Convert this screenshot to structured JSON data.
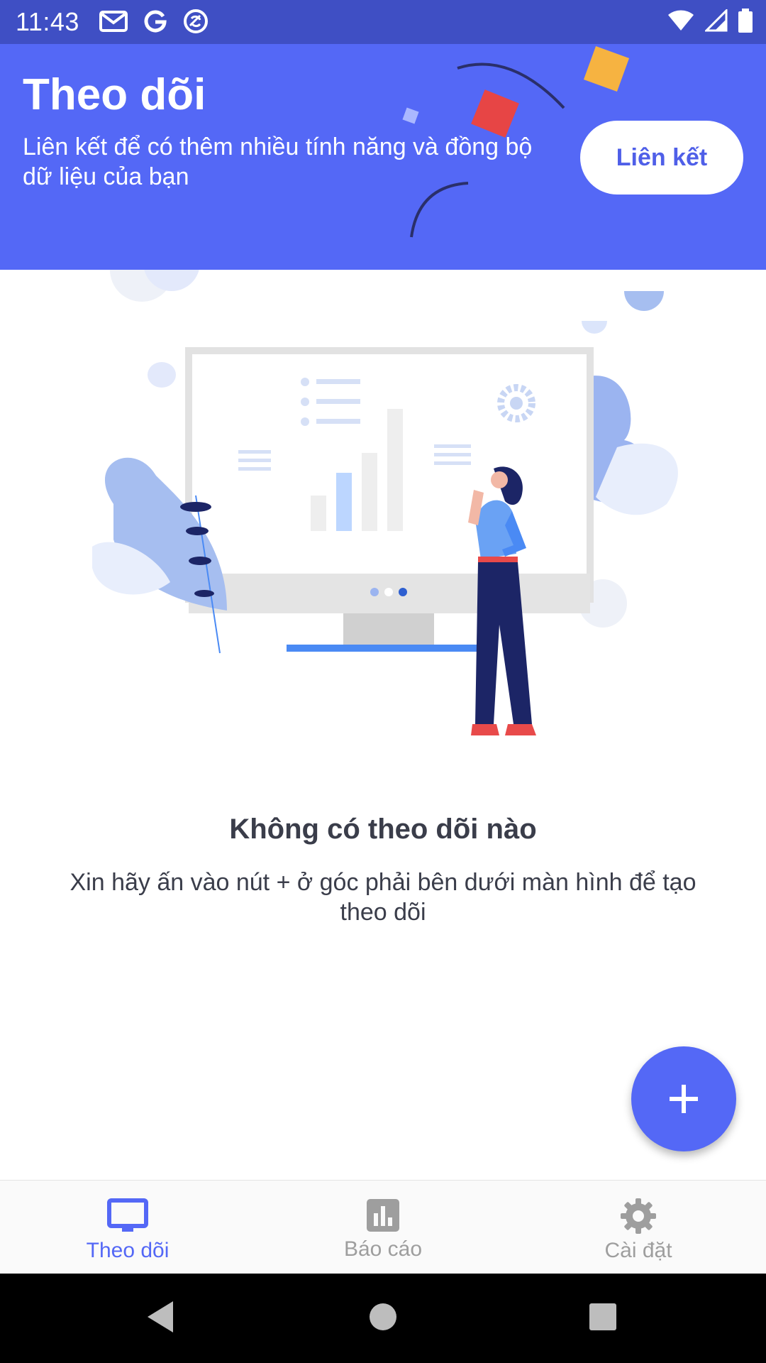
{
  "status_bar": {
    "time": "11:43",
    "icons_left": [
      "gmail-icon",
      "google-icon",
      "sync-icon"
    ],
    "icons_right": [
      "wifi-icon",
      "signal-icon",
      "battery-icon"
    ]
  },
  "header": {
    "title": "Theo dõi",
    "subtitle": "Liên kết để có thêm nhiều tính năng và đồng bộ dữ liệu của bạn",
    "link_button": "Liên kết"
  },
  "empty_state": {
    "title": "Không có theo dõi nào",
    "description": "Xin hãy ấn vào nút + ở góc phải bên dưới màn hình để tạo theo dõi"
  },
  "fab": {
    "icon": "plus-icon"
  },
  "bottom_nav": {
    "items": [
      {
        "label": "Theo dõi",
        "icon": "monitor-icon",
        "active": true
      },
      {
        "label": "Báo cáo",
        "icon": "bar-chart-icon",
        "active": false
      },
      {
        "label": "Cài đặt",
        "icon": "gear-icon",
        "active": false
      }
    ]
  },
  "colors": {
    "primary": "#5468f6",
    "status_bar": "#3f4fc4",
    "text_dark": "#3a3d4a",
    "inactive": "#9e9e9e"
  }
}
